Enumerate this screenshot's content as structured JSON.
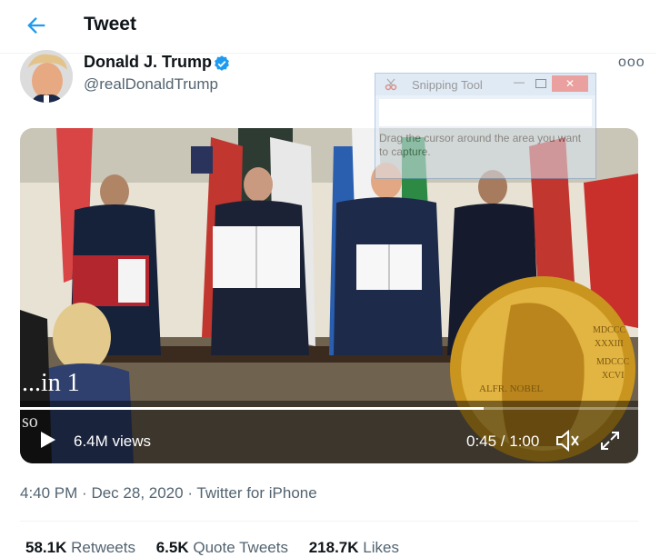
{
  "header": {
    "title": "Tweet"
  },
  "author": {
    "name": "Donald J. Trump",
    "handle": "@realDonaldTrump"
  },
  "more_label": "ooo",
  "snipping_tool": {
    "title": "Snipping Tool",
    "message": "Drag the cursor around the area you want to capture."
  },
  "video": {
    "overlay_text": "...in 1",
    "overlay_text2": "so",
    "views": "6.4M views",
    "time": "0:45 / 1:00",
    "progress": 0.75
  },
  "meta": {
    "time": "4:40 PM",
    "date": "Dec 28, 2020",
    "source": "Twitter for iPhone",
    "sep": "·"
  },
  "stats": {
    "retweets_count": "58.1K",
    "retweets_label": "Retweets",
    "quotes_count": "6.5K",
    "quotes_label": "Quote Tweets",
    "likes_count": "218.7K",
    "likes_label": "Likes"
  },
  "colors": {
    "accent": "#1d9bf0",
    "text": "#0f1419",
    "secondary": "#536471"
  },
  "icons": [
    "back-arrow-icon",
    "verified-badge-icon",
    "more-icon",
    "play-icon",
    "volume-icon",
    "expand-icon"
  ]
}
